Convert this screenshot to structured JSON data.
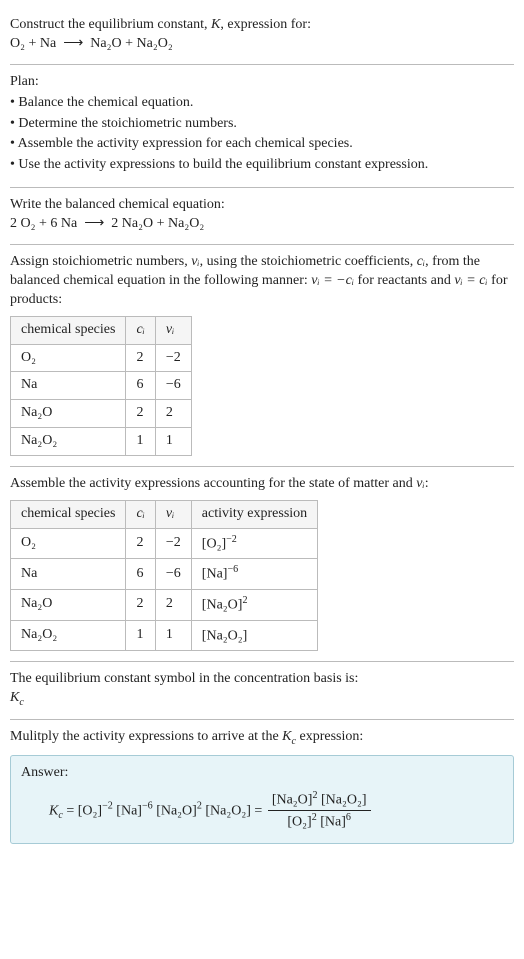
{
  "intro": {
    "line1_pre": "Construct the equilibrium constant, ",
    "line1_K": "K",
    "line1_post": ", expression for:",
    "reaction_lhs": "O₂ + Na",
    "arrow": "⟶",
    "reaction_rhs": "Na₂O + Na₂O₂"
  },
  "plan": {
    "heading": "Plan:",
    "b1": "• Balance the chemical equation.",
    "b2": "• Determine the stoichiometric numbers.",
    "b3": "• Assemble the activity expression for each chemical species.",
    "b4": "• Use the activity expressions to build the equilibrium constant expression."
  },
  "balanced": {
    "heading": "Write the balanced chemical equation:",
    "lhs": "2 O₂ + 6 Na",
    "arrow": "⟶",
    "rhs": "2 Na₂O + Na₂O₂"
  },
  "stoich": {
    "text_a": "Assign stoichiometric numbers, ",
    "nu": "νᵢ",
    "text_b": ", using the stoichiometric coefficients, ",
    "ci": "cᵢ",
    "text_c": ", from the balanced chemical equation in the following manner: ",
    "rel1": "νᵢ = −cᵢ",
    "text_d": " for reactants and ",
    "rel2": "νᵢ = cᵢ",
    "text_e": " for products:",
    "headers": {
      "species": "chemical species",
      "c": "cᵢ",
      "nu": "νᵢ"
    },
    "rows": [
      {
        "species": "O₂",
        "c": "2",
        "nu": "−2"
      },
      {
        "species": "Na",
        "c": "6",
        "nu": "−6"
      },
      {
        "species": "Na₂O",
        "c": "2",
        "nu": "2"
      },
      {
        "species": "Na₂O₂",
        "c": "1",
        "nu": "1"
      }
    ]
  },
  "activity": {
    "text_a": "Assemble the activity expressions accounting for the state of matter and ",
    "nu": "νᵢ",
    "text_b": ":",
    "headers": {
      "species": "chemical species",
      "c": "cᵢ",
      "nu": "νᵢ",
      "act": "activity expression"
    },
    "rows": [
      {
        "species": "O₂",
        "c": "2",
        "nu": "−2",
        "act_base": "[O₂]",
        "act_exp": "−2"
      },
      {
        "species": "Na",
        "c": "6",
        "nu": "−6",
        "act_base": "[Na]",
        "act_exp": "−6"
      },
      {
        "species": "Na₂O",
        "c": "2",
        "nu": "2",
        "act_base": "[Na₂O]",
        "act_exp": "2"
      },
      {
        "species": "Na₂O₂",
        "c": "1",
        "nu": "1",
        "act_base": "[Na₂O₂]",
        "act_exp": ""
      }
    ]
  },
  "symbol_section": {
    "text": "The equilibrium constant symbol in the concentration basis is:",
    "Kc": "K_c",
    "K": "K",
    "c": "c"
  },
  "final": {
    "heading": "Mulitply the activity expressions to arrive at the ",
    "Kc_label_K": "K",
    "Kc_label_c": "c",
    "heading_post": " expression:",
    "answer_label": "Answer:",
    "eq_lhs_K": "K",
    "eq_lhs_c": "c",
    "eq_eq": " = ",
    "t1_base": "[O₂]",
    "t1_exp": "−2",
    "t2_base": "[Na]",
    "t2_exp": "−6",
    "t3_base": "[Na₂O]",
    "t3_exp": "2",
    "t4_base": "[Na₂O₂]",
    "eq_eq2": " = ",
    "num1_base": "[Na₂O]",
    "num1_exp": "2",
    "num2_base": "[Na₂O₂]",
    "den1_base": "[O₂]",
    "den1_exp": "2",
    "den2_base": "[Na]",
    "den2_exp": "6"
  }
}
